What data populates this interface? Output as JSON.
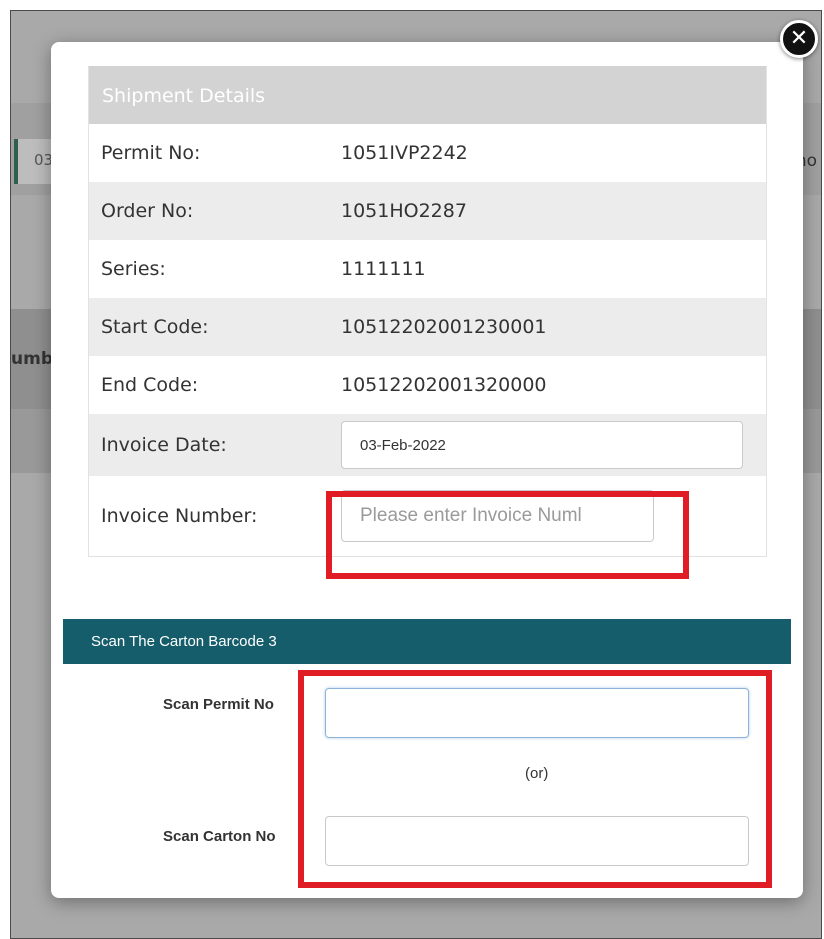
{
  "background": {
    "tab_fragment": "03",
    "right_fragment": "Who",
    "left_fragment": "umb"
  },
  "modal": {
    "close_icon": "close-icon",
    "header": "Shipment Details",
    "details": [
      {
        "label": "Permit No:",
        "value": "1051IVP2242"
      },
      {
        "label": "Order No:",
        "value": "1051HO2287"
      },
      {
        "label": "Series:",
        "value": "1111111"
      },
      {
        "label": "Start Code:",
        "value": "10512202001230001"
      },
      {
        "label": "End Code:",
        "value": "10512202001320000"
      }
    ],
    "invoice_date": {
      "label": "Invoice Date:",
      "value": "03-Feb-2022"
    },
    "invoice_number": {
      "label": "Invoice Number:",
      "placeholder": "Please enter Invoice Numl"
    },
    "scan_section": {
      "title": "Scan The Carton Barcode  3",
      "permit_label": "Scan Permit No",
      "or_text": "(or)",
      "carton_label": "Scan Carton No"
    }
  },
  "colors": {
    "header_bg": "#d3d3d3",
    "scan_bar_bg": "#155d6b",
    "highlight": "#e01c24"
  }
}
